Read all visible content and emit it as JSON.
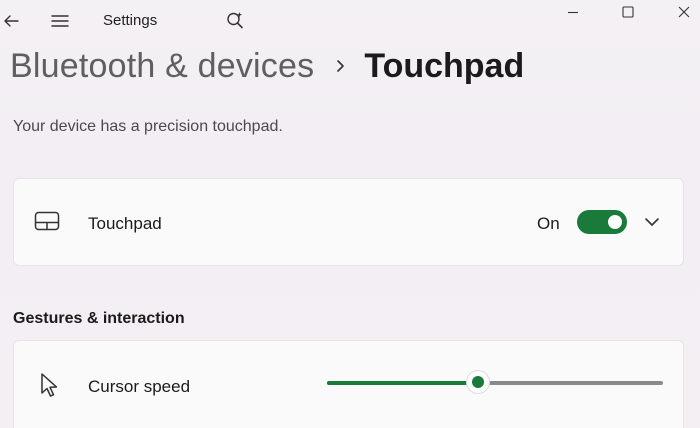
{
  "titlebar": {
    "title": "Settings",
    "icons": {
      "back": "back-arrow-icon",
      "menu": "hamburger-menu-icon",
      "search": "search-sparkle-icon",
      "minimize": "minimize-icon",
      "maximize": "maximize-icon",
      "close": "close-icon"
    }
  },
  "breadcrumb": {
    "parent": "Bluetooth & devices",
    "separator_icon": "chevron-right-icon",
    "current": "Touchpad"
  },
  "subtitle": "Your device has a precision touchpad.",
  "touchpad_card": {
    "icon": "touchpad-icon",
    "label": "Touchpad",
    "toggle_state_text": "On",
    "toggle_on": true,
    "expand_icon": "chevron-down-icon"
  },
  "gestures_section": {
    "title": "Gestures & interaction"
  },
  "cursor_speed": {
    "icon": "cursor-pointer-icon",
    "label": "Cursor speed",
    "value_fraction": 0.45
  },
  "colors": {
    "accent": "#1a7a3a",
    "track": "#8a8a8a"
  }
}
